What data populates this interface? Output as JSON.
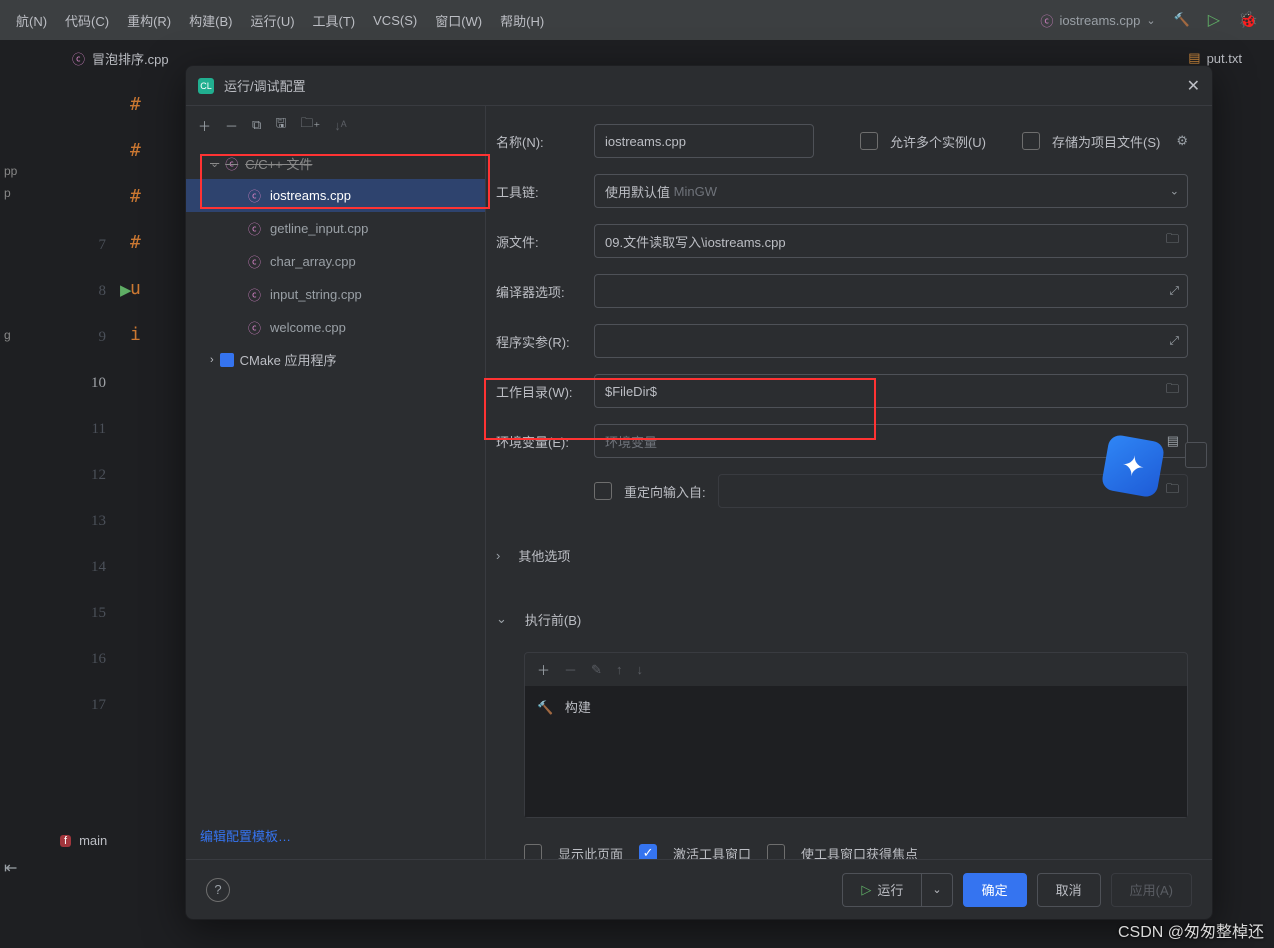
{
  "menubar": {
    "items": [
      "航(N)",
      "代码(C)",
      "重构(R)",
      "构建(B)",
      "运行(U)",
      "工具(T)",
      "VCS(S)",
      "窗口(W)",
      "帮助(H)"
    ],
    "config": "iostreams.cpp"
  },
  "tabs": {
    "t0": "冒泡排序.cpp",
    "t1": "put.txt"
  },
  "gutter": [
    "7",
    "8",
    "9",
    "10",
    "11",
    "12",
    "13",
    "14",
    "15",
    "16",
    "17"
  ],
  "code": [
    "#",
    "#",
    "#",
    "#",
    "u",
    "i"
  ],
  "leftcol": [
    "pp",
    "p",
    "g"
  ],
  "bottom": {
    "label": "main"
  },
  "dialog": {
    "title": "运行/调试配置",
    "tree": {
      "group1": "C/C++ 文件",
      "items": [
        "iostreams.cpp",
        "getline_input.cpp",
        "char_array.cpp",
        "input_string.cpp",
        "welcome.cpp"
      ],
      "group2": "CMake 应用程序",
      "editTemplates": "编辑配置模板…"
    },
    "form": {
      "name_label": "名称(N):",
      "name_value": "iostreams.cpp",
      "allow_multi": "允许多个实例(U)",
      "store_project": "存储为项目文件(S)",
      "toolchain_label": "工具链:",
      "toolchain_value": "使用默认值",
      "toolchain_hint": "MinGW",
      "source_label": "源文件:",
      "source_value": "09.文件读取写入\\iostreams.cpp",
      "compiler_label": "编译器选项:",
      "args_label": "程序实参(R):",
      "workdir_label": "工作目录(W):",
      "workdir_value": "$FileDir$",
      "env_label": "环境变量(E):",
      "env_placeholder": "环境变量",
      "redirect": "重定向输入自:",
      "other": "其他选项",
      "before": "执行前(B)",
      "build": "构建",
      "show_page": "显示此页面",
      "activate_tool": "激活工具窗口",
      "focus_tool": "使工具窗口获得焦点"
    },
    "buttons": {
      "run": "运行",
      "ok": "确定",
      "cancel": "取消",
      "apply": "应用(A)"
    }
  },
  "watermark": "CSDN @匆匆整棹还"
}
